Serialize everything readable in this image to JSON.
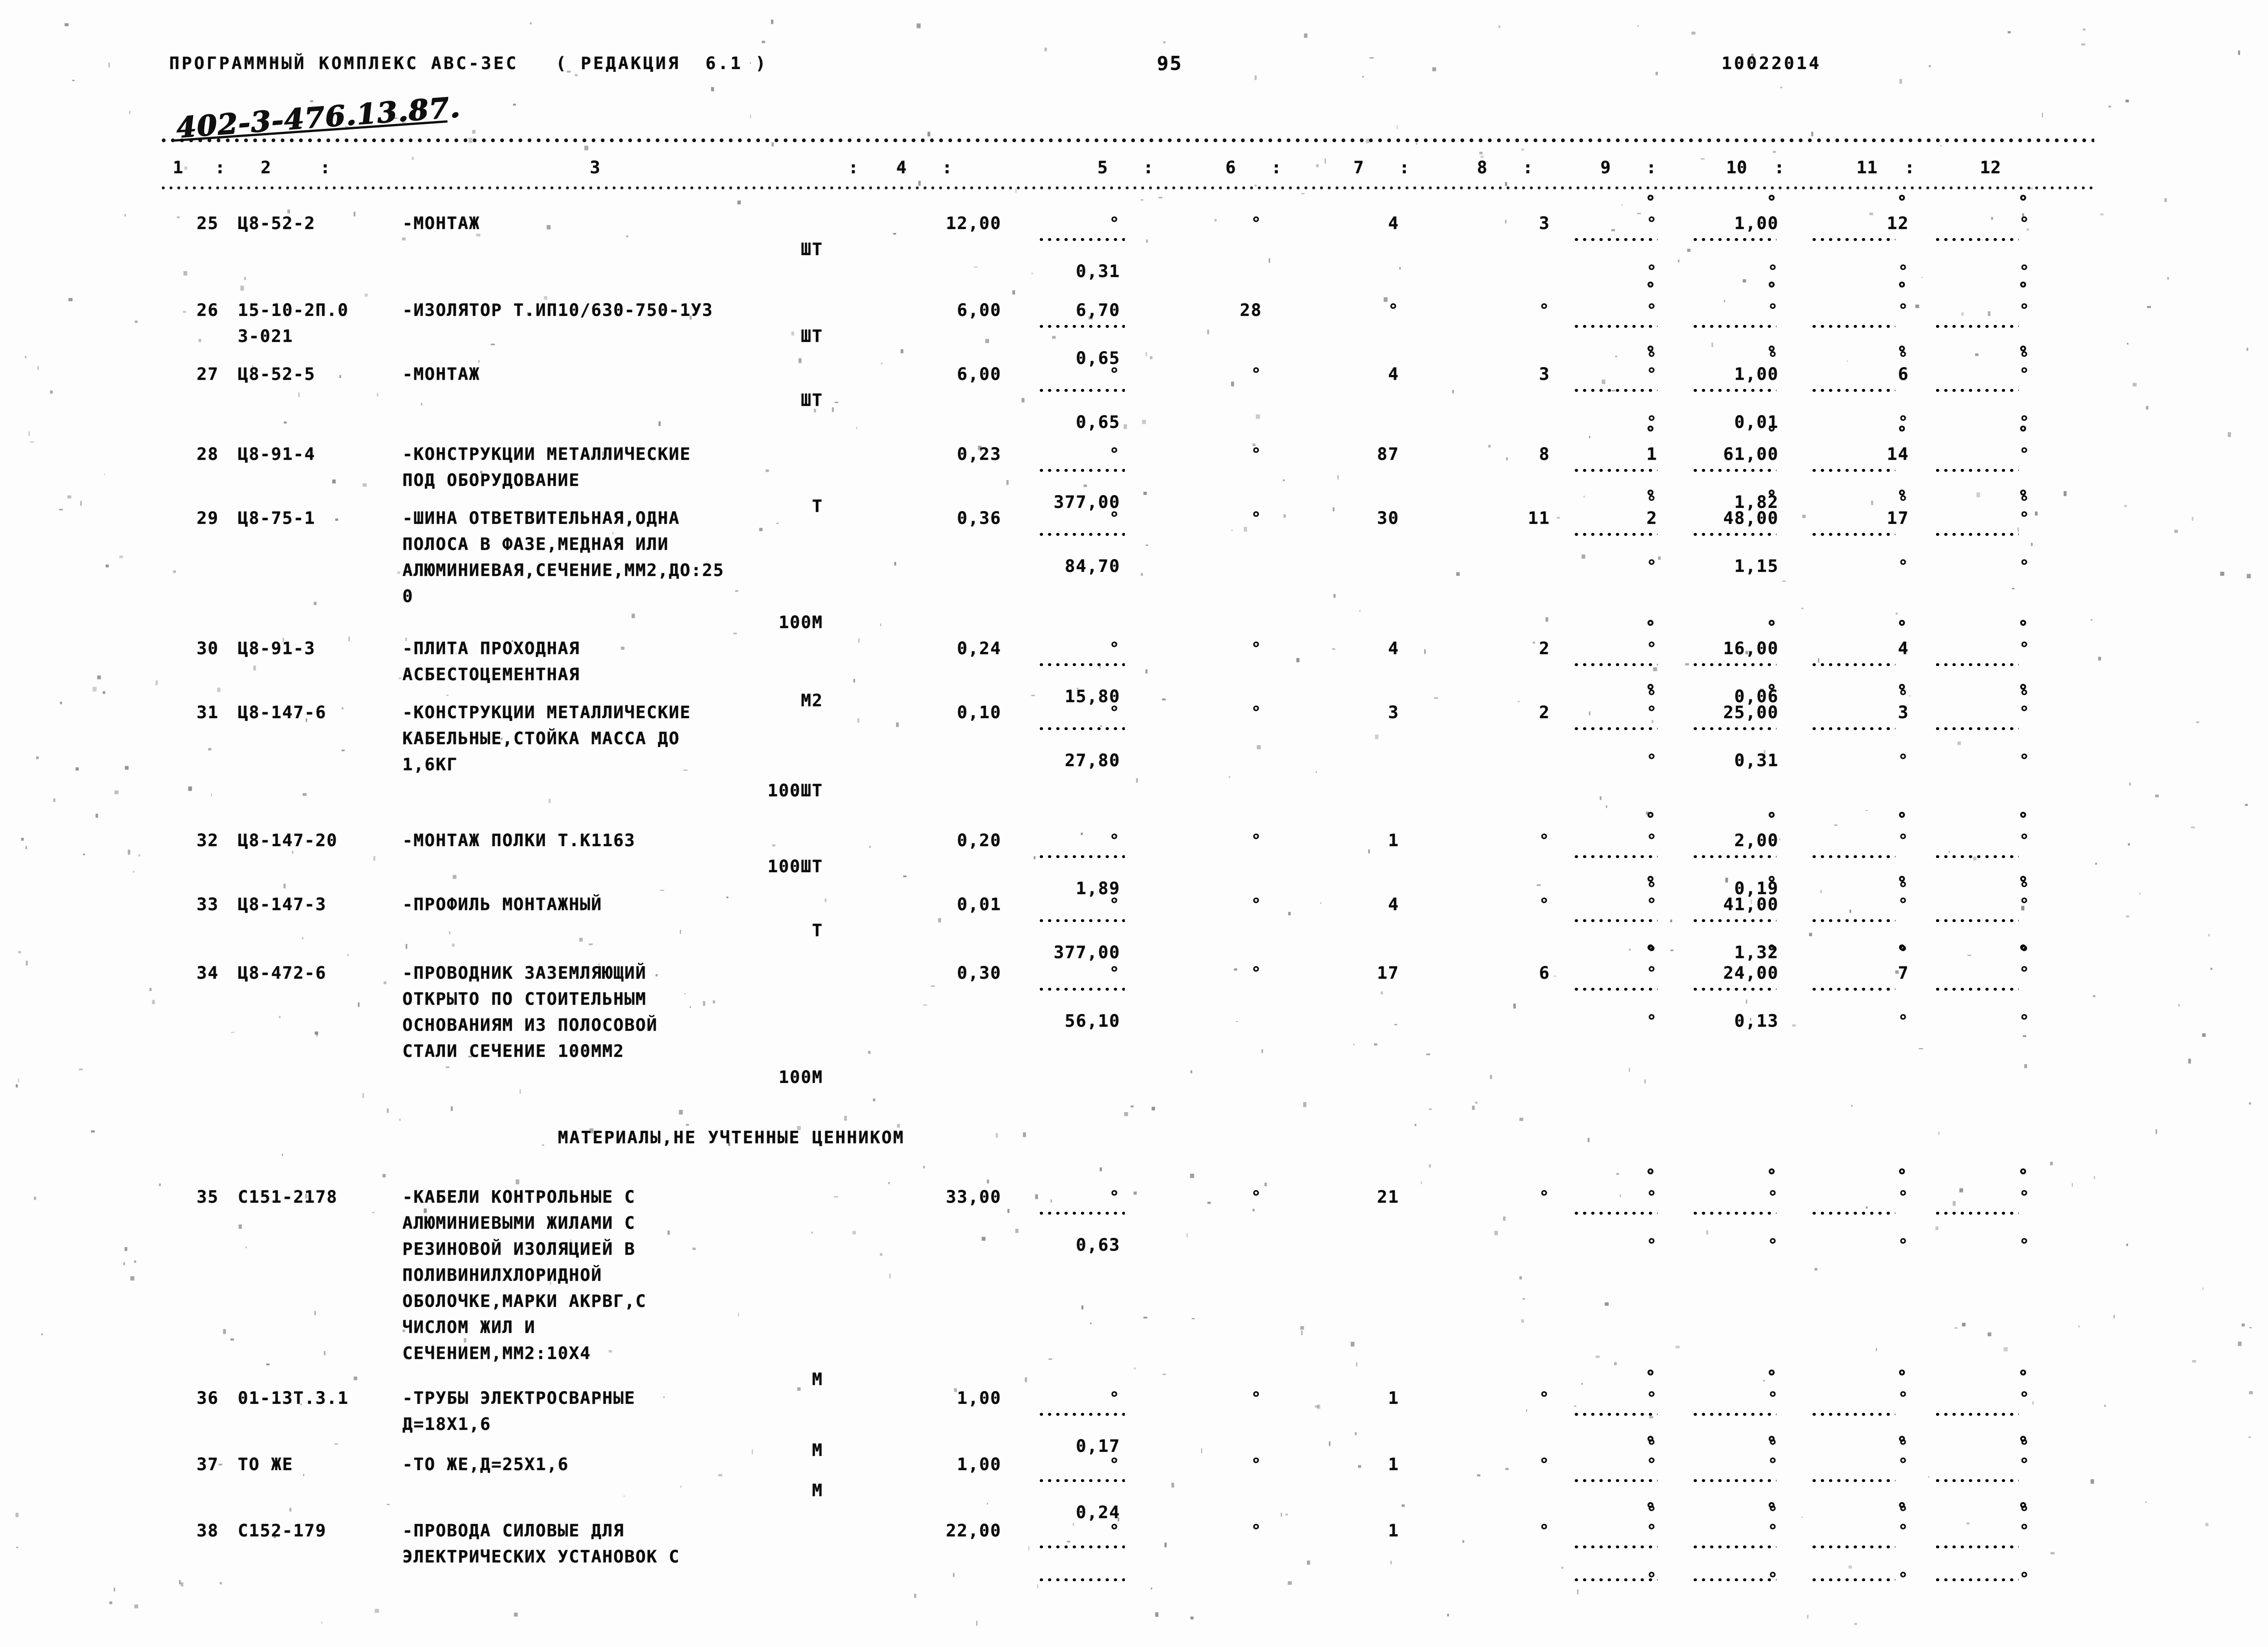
{
  "header": {
    "program_line": "ПРОГРАММНЫЙ КОМПЛЕКС АВС-3ЕС   ( РЕДАКЦИЯ  6.1 )",
    "page_number": "95",
    "doc_number": "10022014",
    "handwritten_note": "402-3-476.13.87."
  },
  "column_headers": [
    "1",
    ":",
    "2",
    ":",
    "3",
    ":",
    "4",
    ":",
    "5",
    ":",
    "6",
    ":",
    "7",
    ":",
    "8",
    ":",
    "9",
    ":",
    "10",
    ":",
    "11",
    ":",
    "12"
  ],
  "column_numbers": [
    "1",
    "2",
    "3",
    "4",
    "5",
    "6",
    "7",
    "8",
    "9",
    "10",
    "11",
    "12"
  ],
  "section_heading": "МАТЕРИАЛЫ,НЕ УЧТЕННЫЕ ЦЕННИКОМ",
  "rows": [
    {
      "no": "25",
      "code": "Ц8-52-2",
      "desc": [
        "-МОНТАЖ"
      ],
      "unit": "ШТ",
      "c4": "12,00",
      "c5_top": "°",
      "c5_bot": "0,31",
      "c6": "°",
      "c7": "4",
      "c8": "3",
      "c9": "°",
      "c10": "1,00",
      "c10_b": "°",
      "c11": "12",
      "c11_b": "°",
      "c12": "°"
    },
    {
      "no": "26",
      "code": "15-10-2П.0",
      "code2": "3-021",
      "desc": [
        "-ИЗОЛЯТОР Т.ИП10/630-750-1У3"
      ],
      "unit": "ШТ",
      "c4": "6,00",
      "c5_top": "6,70",
      "c5_bot": "0,65",
      "c6": "28",
      "c7": "°",
      "c8": "°",
      "c9": "°",
      "c10": "°",
      "c10_b": "°",
      "c11": "°",
      "c11_b": "°",
      "c12": "°"
    },
    {
      "no": "27",
      "code": "Ц8-52-5",
      "desc": [
        "-МОНТАЖ"
      ],
      "unit": "ШТ",
      "c4": "6,00",
      "c5_top": "°",
      "c5_bot": "0,65",
      "c6": "°",
      "c7": "4",
      "c8": "3",
      "c9": "°",
      "c10": "1,00",
      "c10_b": "0,01",
      "c11": "6",
      "c11_b": "°",
      "c12": "°"
    },
    {
      "no": "28",
      "code": "Ц8-91-4",
      "desc": [
        "-КОНСТРУКЦИИ МЕТАЛЛИЧЕСКИЕ",
        "ПОД ОБОРУДОВАНИЕ"
      ],
      "unit": "Т",
      "c4": "0,23",
      "c5_top": "°",
      "c5_bot": "377,00",
      "c6": "°",
      "c7": "87",
      "c8": "8",
      "c9": "1",
      "c10": "61,00",
      "c10_b": "1,82",
      "c11": "14",
      "c11_b": "°",
      "c12": "°"
    },
    {
      "no": "29",
      "code": "Ц8-75-1",
      "desc": [
        "-ШИНА ОТВЕТВИТЕЛЬНАЯ,ОДНА",
        "ПОЛОСА В ФАЗЕ,МЕДНАЯ ИЛИ",
        "АЛЮМИНИЕВАЯ,СЕЧЕНИЕ,ММ2,ДО:25",
        "0"
      ],
      "unit": "100М",
      "c4": "0,36",
      "c5_top": "°",
      "c5_bot": "84,70",
      "c6": "°",
      "c7": "30",
      "c8": "11",
      "c9": "2",
      "c10": "48,00",
      "c10_b": "1,15",
      "c11": "17",
      "c11_b": "°",
      "c12": "°"
    },
    {
      "no": "30",
      "code": "Ц8-91-3",
      "desc": [
        "-ПЛИТА ПРОХОДНАЯ",
        "АСБЕСТОЦЕМЕНТНАЯ"
      ],
      "unit": "М2",
      "c4": "0,24",
      "c5_top": "°",
      "c5_bot": "15,80",
      "c6": "°",
      "c7": "4",
      "c8": "2",
      "c9": "°",
      "c10": "16,00",
      "c10_b": "0,06",
      "c11": "4",
      "c11_b": "°",
      "c12": "°"
    },
    {
      "no": "31",
      "code": "Ц8-147-6",
      "desc": [
        "-КОНСТРУКЦИИ МЕТАЛЛИЧЕСКИЕ",
        "КАБЕЛЬНЫЕ,СТОЙКА МАССА ДО",
        "1,6КГ"
      ],
      "unit": "100ШТ",
      "c4": "0,10",
      "c5_top": "°",
      "c5_bot": "27,80",
      "c6": "°",
      "c7": "3",
      "c8": "2",
      "c9": "°",
      "c10": "25,00",
      "c10_b": "0,31",
      "c11": "3",
      "c11_b": "°",
      "c12": "°"
    },
    {
      "no": "32",
      "code": "Ц8-147-20",
      "desc": [
        "-МОНТАЖ ПОЛКИ Т.К1163"
      ],
      "unit": "100ШТ",
      "c4": "0,20",
      "c5_top": "°",
      "c5_bot": "1,89",
      "c6": "°",
      "c7": "1",
      "c8": "°",
      "c9": "°",
      "c10": "2,00",
      "c10_b": "0,19",
      "c11": "°",
      "c11_b": "°",
      "c12": "°"
    },
    {
      "no": "33",
      "code": "Ц8-147-3",
      "desc": [
        "-ПРОФИЛЬ МОНТАЖНЫЙ"
      ],
      "unit": "Т",
      "c4": "0,01",
      "c5_top": "°",
      "c5_bot": "377,00",
      "c6": "°",
      "c7": "4",
      "c8": "°",
      "c9": "°",
      "c10": "41,00",
      "c10_b": "1,32",
      "c11": "°",
      "c11_b": "°",
      "c12": "°"
    },
    {
      "no": "34",
      "code": "Ц8-472-6",
      "desc": [
        "-ПРОВОДНИК ЗАЗЕМЛЯЮЩИЙ",
        "ОТКРЫТО ПО СТОИТЕЛЬНЫМ",
        "ОСНОВАНИЯМ ИЗ ПОЛОСОВОЙ",
        "СТАЛИ СЕЧЕНИЕ 100ММ2"
      ],
      "unit": "100М",
      "c4": "0,30",
      "c5_top": "°",
      "c5_bot": "56,10",
      "c6": "°",
      "c7": "17",
      "c8": "6",
      "c9": "°",
      "c10": "24,00",
      "c10_b": "0,13",
      "c11": "7",
      "c11_b": "°",
      "c12": "°"
    },
    {
      "no": "35",
      "code": "С151-2178",
      "desc": [
        "-КАБЕЛИ КОНТРОЛЬНЫЕ С",
        "АЛЮМИНИЕВЫМИ ЖИЛАМИ С",
        "РЕЗИНОВОЙ ИЗОЛЯЦИЕЙ В",
        "ПОЛИВИНИЛХЛОРИДНОЙ",
        "ОБОЛОЧКЕ,МАРКИ АКРВГ,С",
        "ЧИСЛОМ ЖИЛ И",
        "СЕЧЕНИЕМ,ММ2:10Х4"
      ],
      "unit": "М",
      "c4": "33,00",
      "c5_top": "°",
      "c5_bot": "0,63",
      "c6": "°",
      "c7": "21",
      "c8": "°",
      "c9": "°",
      "c10": "°",
      "c10_b": "°",
      "c11": "°",
      "c11_b": "°",
      "c12": "°"
    },
    {
      "no": "36",
      "code": "01-13Т.3.1",
      "desc": [
        "-ТРУБЫ ЭЛЕКТРОСВАРНЫЕ",
        "Д=18Х1,6"
      ],
      "unit": "М",
      "c4": "1,00",
      "c5_top": "°",
      "c5_bot": "0,17",
      "c6": "°",
      "c7": "1",
      "c8": "°",
      "c9": "°",
      "c10": "°",
      "c10_b": "°",
      "c11": "°",
      "c11_b": "°",
      "c12": "°"
    },
    {
      "no": "37",
      "code": "ТО ЖЕ",
      "desc": [
        "-ТО ЖЕ,Д=25Х1,6"
      ],
      "unit": "М",
      "c4": "1,00",
      "c5_top": "°",
      "c5_bot": "0,24",
      "c6": "°",
      "c7": "1",
      "c8": "°",
      "c9": "°",
      "c10": "°",
      "c10_b": "°",
      "c11": "°",
      "c11_b": "°",
      "c12": "°"
    },
    {
      "no": "38",
      "code": "С152-179",
      "desc": [
        "-ПРОВОДА СИЛОВЫЕ ДЛЯ",
        "ЭЛЕКТРИЧЕСКИХ УСТАНОВОК С"
      ],
      "unit": "",
      "c4": "22,00",
      "c5_top": "°",
      "c5_bot": "",
      "c6": "°",
      "c7": "1",
      "c8": "°",
      "c9": "°",
      "c10": "°",
      "c10_b": "°",
      "c11": "°",
      "c11_b": "°",
      "c12": "°"
    }
  ]
}
